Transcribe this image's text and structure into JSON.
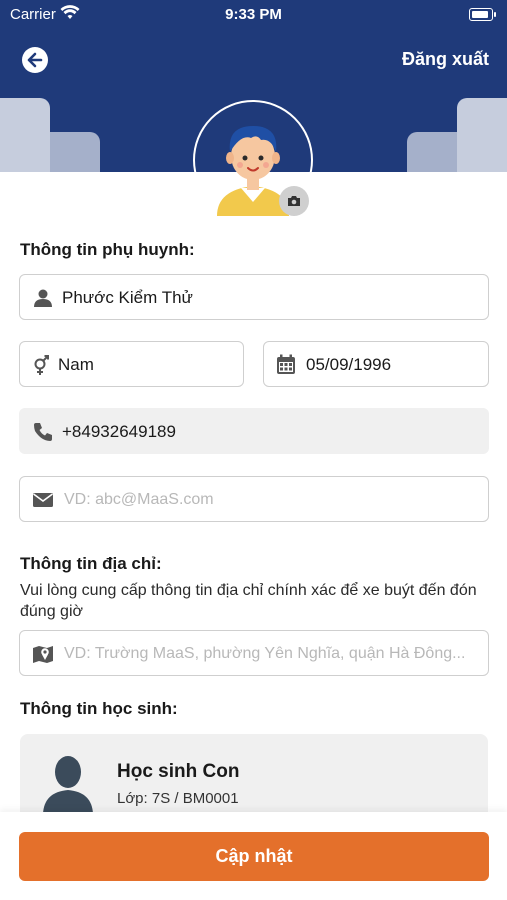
{
  "status_bar": {
    "carrier": "Carrier",
    "time": "9:33 PM"
  },
  "header": {
    "logout_label": "Đăng xuất",
    "color": "#1f3a7a"
  },
  "parent_section": {
    "title": "Thông tin phụ huynh:",
    "name": "Phước Kiểm Thử",
    "gender": "Nam",
    "birthdate": "05/09/1996",
    "phone": "+84932649189",
    "email_placeholder": "VD: abc@MaaS.com"
  },
  "address_section": {
    "title": "Thông tin địa chỉ:",
    "description": "Vui lòng cung cấp thông tin địa chỉ chính xác để xe buýt đến đón đúng giờ",
    "address_placeholder": "VD: Trường MaaS, phường Yên Nghĩa, quận Hà Đông..."
  },
  "student_section": {
    "title": "Thông tin học sinh:",
    "student": {
      "name": "Học sinh Con",
      "class_info": "Lớp: 7S / BM0001"
    }
  },
  "update_button": {
    "label": "Cập nhật",
    "color": "#e4702b"
  }
}
